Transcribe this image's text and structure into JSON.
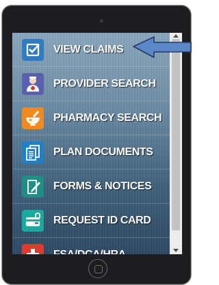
{
  "menu": {
    "items": [
      {
        "label": "VIEW CLAIMS",
        "icon": "checkbox-icon",
        "color": "#2f7cc4"
      },
      {
        "label": "PROVIDER SEARCH",
        "icon": "doctor-icon",
        "color": "#5a5fb0"
      },
      {
        "label": "PHARMACY SEARCH",
        "icon": "mortar-pestle-icon",
        "color": "#f08a1c"
      },
      {
        "label": "PLAN DOCUMENTS",
        "icon": "documents-icon",
        "color": "#1f7fc7"
      },
      {
        "label": "FORMS & NOTICES",
        "icon": "form-edit-icon",
        "color": "#1f8f83"
      },
      {
        "label": "REQUEST ID CARD",
        "icon": "id-card-lock-icon",
        "color": "#1aa99d"
      },
      {
        "label": "FSA/DCA/HRA",
        "icon": "medical-cross-icon",
        "color": "#e03a2f"
      }
    ]
  },
  "highlight_arrow_color": "#5b86c7"
}
